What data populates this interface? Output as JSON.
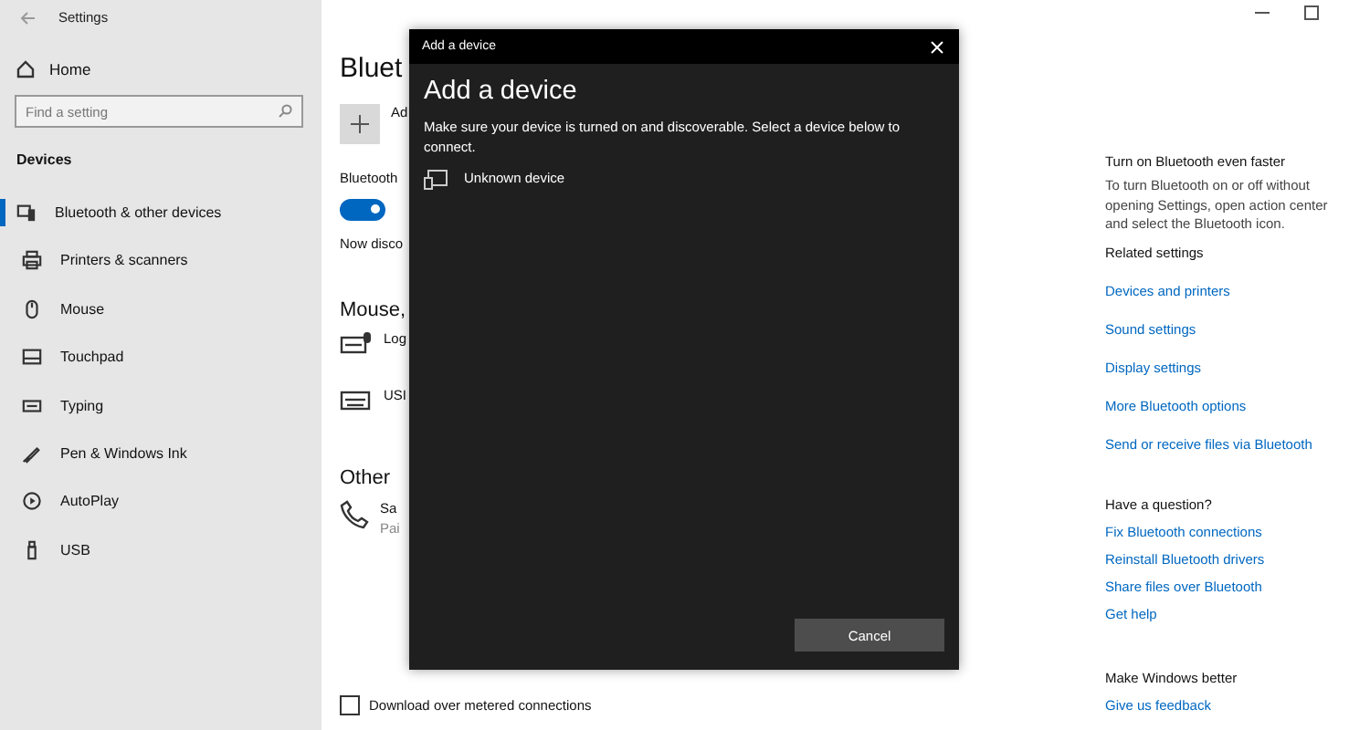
{
  "window": {
    "title": "Settings"
  },
  "sidebar": {
    "home": "Home",
    "search": {
      "placeholder": "Find a setting"
    },
    "section": "Devices",
    "items": [
      {
        "label": "Bluetooth & other devices",
        "selected": true
      },
      {
        "label": "Printers & scanners",
        "selected": false
      },
      {
        "label": "Mouse",
        "selected": false
      },
      {
        "label": "Touchpad",
        "selected": false
      },
      {
        "label": "Typing",
        "selected": false
      },
      {
        "label": "Pen & Windows Ink",
        "selected": false
      },
      {
        "label": "AutoPlay",
        "selected": false
      },
      {
        "label": "USB",
        "selected": false
      }
    ]
  },
  "main": {
    "title": "Bluet",
    "add_label": "Ad",
    "bluetooth_label": "Bluetooth",
    "toggle": {
      "on": true
    },
    "discoverable": "Now disco",
    "mouse_heading": "Mouse,",
    "mouse_devices": [
      {
        "name": "Log"
      },
      {
        "name": "USI"
      }
    ],
    "other_heading": "Other",
    "other_devices": [
      {
        "name": "Sa",
        "status": "Pai"
      }
    ],
    "metered": {
      "label": "Download over metered connections",
      "checked": false
    }
  },
  "dialog": {
    "title_bar": "Add a device",
    "heading": "Add a device",
    "text": "Make sure your device is turned on and discoverable. Select a device below to connect.",
    "devices": [
      {
        "name": "Unknown device"
      }
    ],
    "cancel": "Cancel"
  },
  "aside": {
    "tip_title": "Turn on Bluetooth even faster",
    "tip_text": "To turn Bluetooth on or off without opening Settings, open action center and select the Bluetooth icon.",
    "groups": [
      {
        "title": "Related settings",
        "links": [
          "Devices and printers",
          "Sound settings",
          "Display settings",
          "More Bluetooth options",
          "Send or receive files via Bluetooth"
        ]
      },
      {
        "title": "Have a question?",
        "links": [
          "Fix Bluetooth connections",
          "Reinstall Bluetooth drivers",
          "Share files over Bluetooth",
          "Get help"
        ]
      },
      {
        "title": "Make Windows better",
        "links": [
          "Give us feedback"
        ]
      }
    ]
  }
}
